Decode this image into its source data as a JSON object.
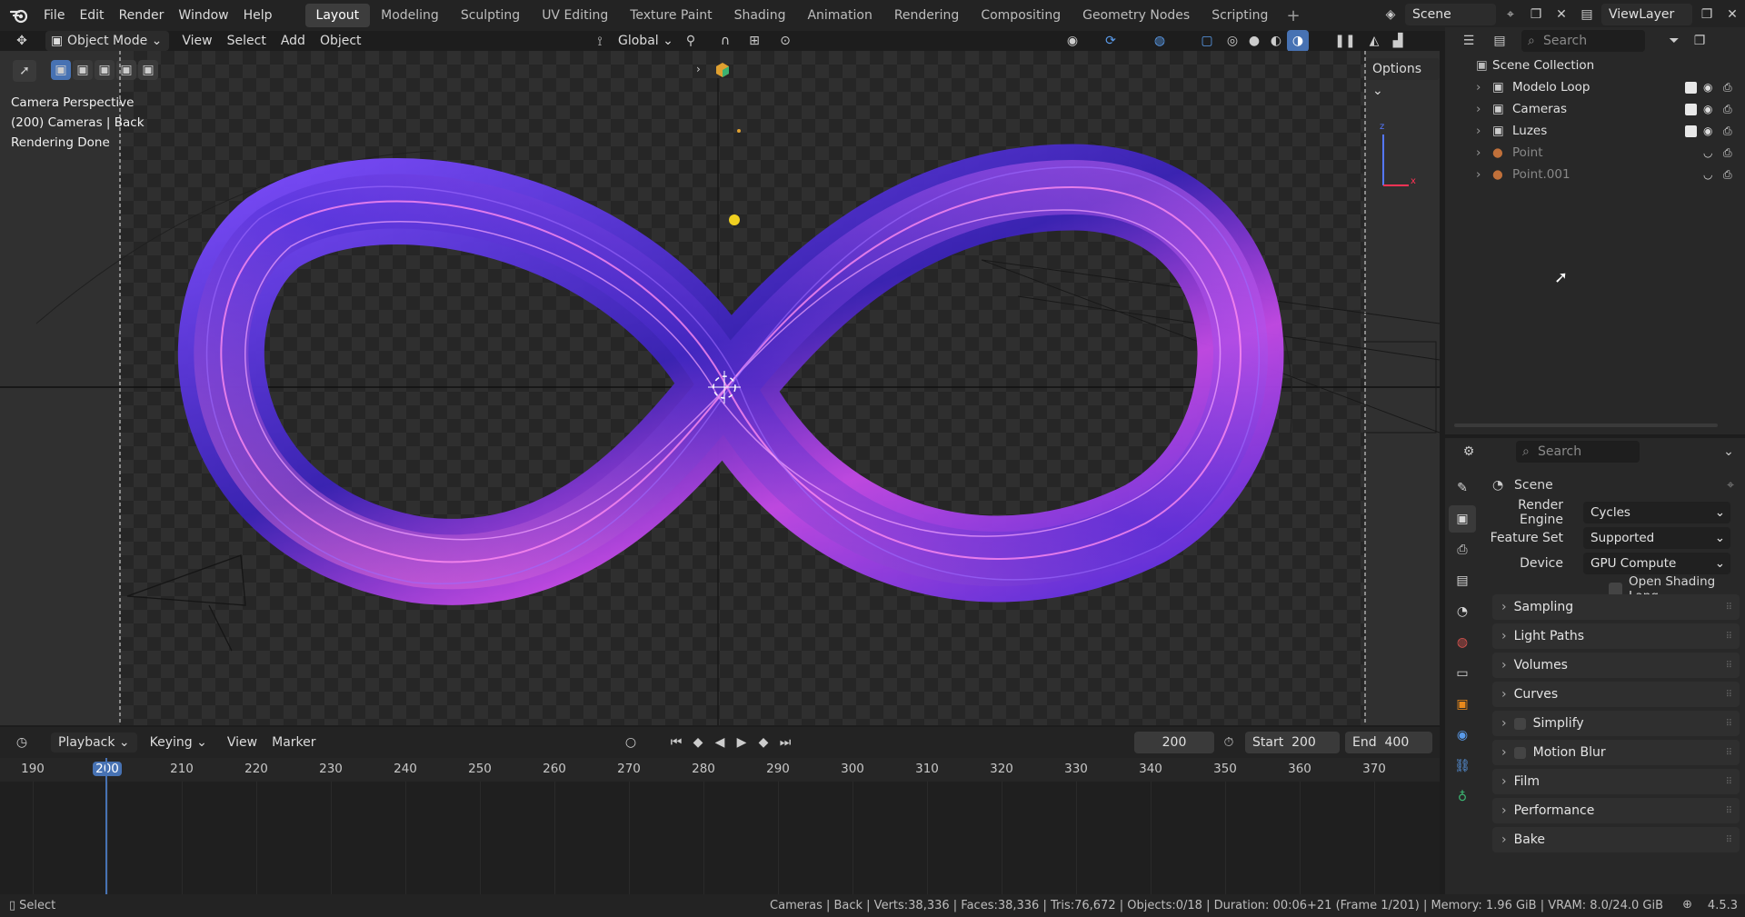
{
  "topbar": {
    "menus": [
      "File",
      "Edit",
      "Render",
      "Window",
      "Help"
    ],
    "workspaces": [
      "Layout",
      "Modeling",
      "Sculpting",
      "UV Editing",
      "Texture Paint",
      "Shading",
      "Animation",
      "Rendering",
      "Compositing",
      "Geometry Nodes",
      "Scripting"
    ],
    "active_workspace": "Layout",
    "scene": "Scene",
    "view_layer": "ViewLayer"
  },
  "viewport": {
    "mode": "Object Mode",
    "menus": [
      "View",
      "Select",
      "Add",
      "Object"
    ],
    "orientation": "Global",
    "options_label": "Options",
    "overlay_text": [
      "Camera Perspective",
      "(200) Cameras | Back",
      "Rendering Done"
    ],
    "colors": {
      "ribbon_a": "#6a3cff",
      "ribbon_b": "#d04cf0",
      "ribbon_c": "#2a1a7a"
    }
  },
  "outliner": {
    "search_placeholder": "Search",
    "root": "Scene Collection",
    "items": [
      {
        "name": "Modelo Loop",
        "dim": false
      },
      {
        "name": "Cameras",
        "dim": false
      },
      {
        "name": "Luzes",
        "dim": false
      },
      {
        "name": "Point",
        "dim": true
      },
      {
        "name": "Point.001",
        "dim": true
      }
    ]
  },
  "properties": {
    "search_placeholder": "Search",
    "context": "Scene",
    "render_engine_label": "Render Engine",
    "render_engine": "Cycles",
    "feature_set_label": "Feature Set",
    "feature_set": "Supported",
    "device_label": "Device",
    "device": "GPU Compute",
    "osl_label": "Open Shading Lang...",
    "panels": [
      "Sampling",
      "Light Paths",
      "Volumes",
      "Curves",
      "Simplify",
      "Motion Blur",
      "Film",
      "Performance",
      "Bake"
    ]
  },
  "timeline": {
    "menus": [
      "Playback",
      "Keying",
      "View",
      "Marker"
    ],
    "current_frame": "200",
    "start_label": "Start",
    "start": "200",
    "end_label": "End",
    "end": "400",
    "ticks": [
      "190",
      "200",
      "210",
      "220",
      "230",
      "240",
      "250",
      "260",
      "270",
      "280",
      "290",
      "300",
      "310",
      "320",
      "330",
      "340",
      "350",
      "360",
      "370"
    ]
  },
  "status": {
    "left": "Select",
    "right": "Cameras | Back | Verts:38,336 | Faces:38,336 | Tris:76,672 | Objects:0/18 | Duration: 00:06+21 (Frame 1/201) | Memory: 1.96 GiB | VRAM: 8.0/24.0 GiB",
    "version": "4.5.3"
  }
}
